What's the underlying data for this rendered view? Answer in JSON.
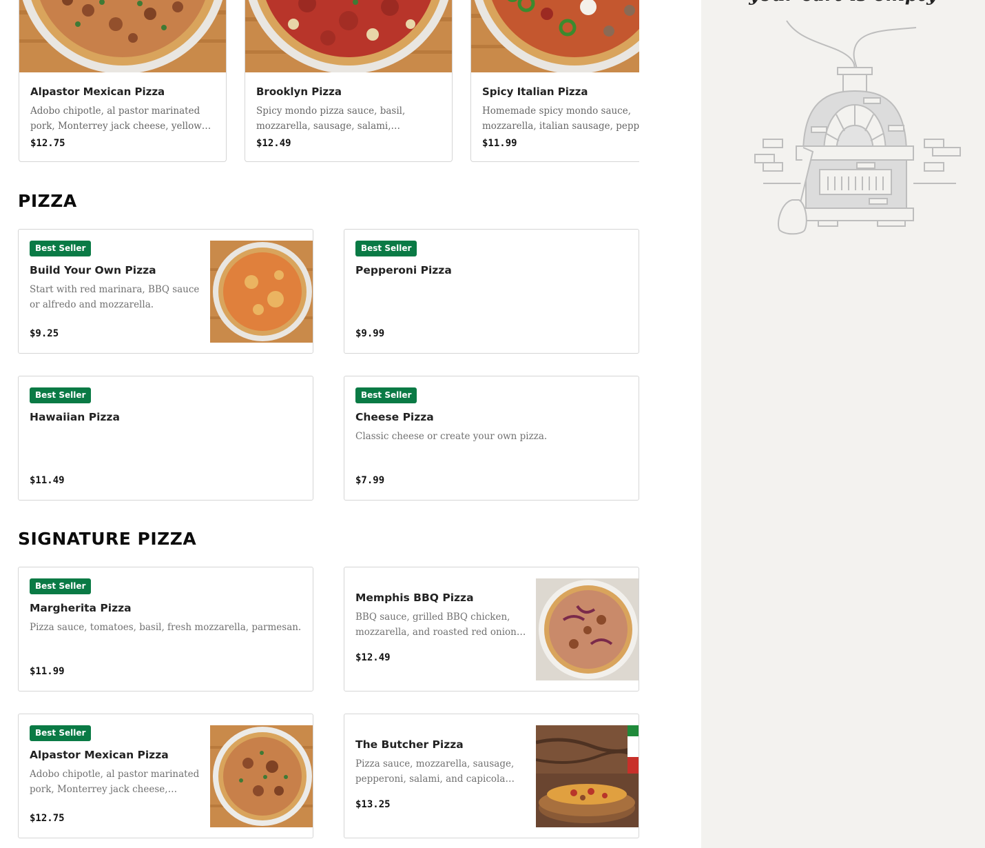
{
  "featured": [
    {
      "name": "Alpastor Mexican Pizza",
      "description": "Adobo chipotle, al pastor marinated pork, Monterrey jack cheese, yellow onions, cilantro.",
      "price": "$12.75"
    },
    {
      "name": "Brooklyn Pizza",
      "description": "Spicy mondo pizza sauce, basil, mozzarella, sausage, salami, pepperoni, parmesan.",
      "price": "$12.49"
    },
    {
      "name": "Spicy Italian Pizza",
      "description": "Homemade spicy mondo sauce, mozzarella, italian sausage, pepperoni, jalapenos.",
      "price": "$11.99"
    }
  ],
  "sections": {
    "pizza": {
      "title": "PIZZA",
      "items": [
        {
          "badge": "Best Seller",
          "name": "Build Your Own Pizza",
          "description": "Start with red marinara, BBQ sauce or alfredo and mozzarella.",
          "price": "$9.25"
        },
        {
          "badge": "Best Seller",
          "name": "Pepperoni Pizza",
          "description": "",
          "price": "$9.99"
        },
        {
          "badge": "Best Seller",
          "name": "Hawaiian Pizza",
          "description": "",
          "price": "$11.49"
        },
        {
          "badge": "Best Seller",
          "name": "Cheese Pizza",
          "description": "Classic cheese or create your own pizza.",
          "price": "$7.99"
        }
      ]
    },
    "signature": {
      "title": "SIGNATURE PIZZA",
      "items": [
        {
          "badge": "Best Seller",
          "name": "Margherita Pizza",
          "description": "Pizza sauce, tomatoes, basil, fresh mozzarella, parmesan.",
          "price": "$11.99"
        },
        {
          "name": "Memphis BBQ Pizza",
          "description": "BBQ sauce, grilled BBQ chicken, mozzarella, and roasted red onion slices.",
          "price": "$12.49"
        },
        {
          "badge": "Best Seller",
          "name": "Alpastor Mexican Pizza",
          "description": "Adobo chipotle, al pastor marinated pork, Monterrey jack cheese, yellow onions.",
          "price": "$12.75"
        },
        {
          "name": "The Butcher Pizza",
          "description": "Pizza sauce, mozzarella, sausage, pepperoni, salami, and capicola ham.",
          "price": "$13.25"
        }
      ]
    }
  },
  "cart": {
    "empty_text": "your cart is empty",
    "illustration": "pizza-oven-illustration"
  },
  "colors": {
    "badge": "#0a7a45",
    "panel": "#f3f2ef",
    "border": "#d5d5d5"
  }
}
